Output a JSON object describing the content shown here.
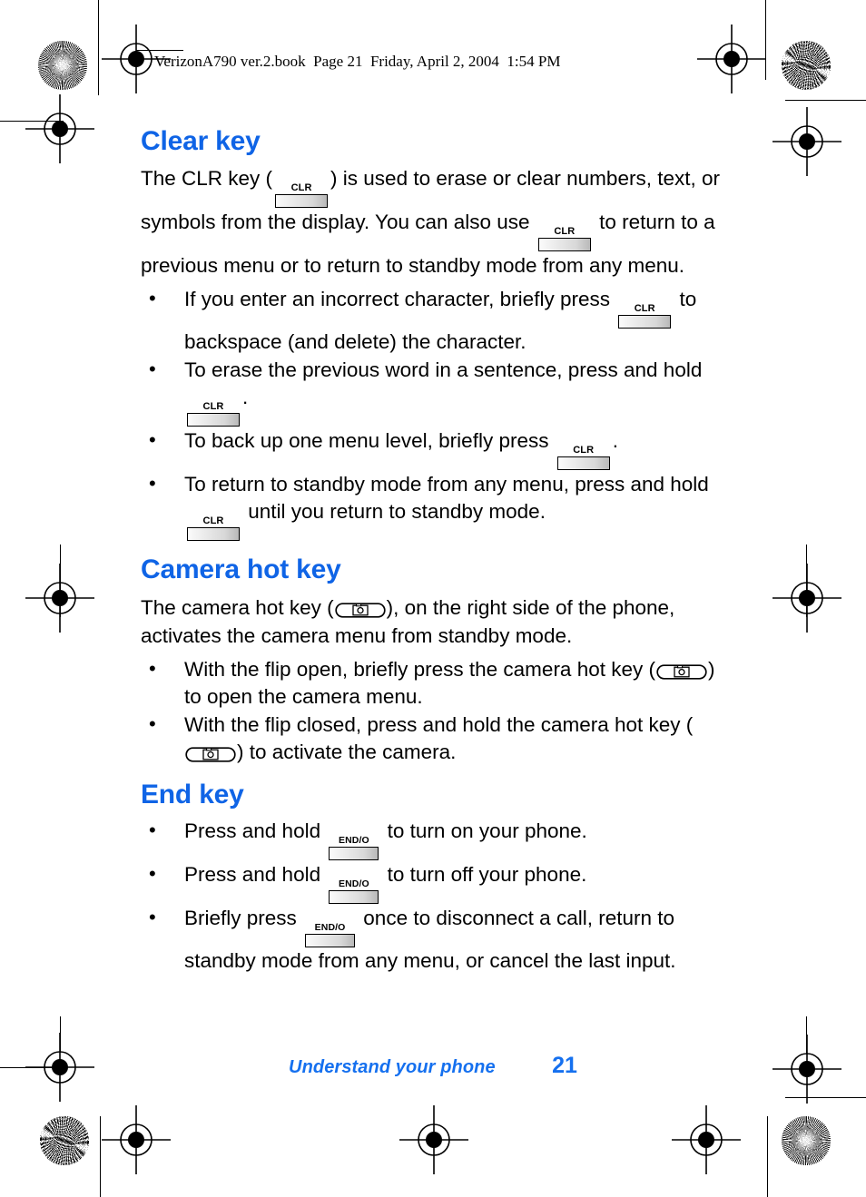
{
  "page_header": "VerizonA790 ver.2.book  Page 21  Friday, April 2, 2004  1:54 PM",
  "colors": {
    "heading_blue": "#0f64e6",
    "footer_blue": "#1570ef",
    "body_black": "#000000"
  },
  "keys": {
    "clr_label": "CLR",
    "end_label": "END/O",
    "camera_icon_name": "camera-hot-key-icon"
  },
  "sections": [
    {
      "id": "clear-key",
      "title": "Clear key",
      "paragraphs": [
        {
          "runs": [
            {
              "t": "text",
              "v": "The CLR key ("
            },
            {
              "t": "key-clr"
            },
            {
              "t": "text",
              "v": ") is used to erase or clear numbers, text, or symbols from the display. You can also use "
            },
            {
              "t": "key-clr"
            },
            {
              "t": "text",
              "v": " to return to a previous menu or to return to standby mode from any menu."
            }
          ]
        }
      ],
      "bullets": [
        {
          "runs": [
            {
              "t": "text",
              "v": "If you enter an incorrect character, briefly press "
            },
            {
              "t": "key-clr"
            },
            {
              "t": "text",
              "v": " to backspace (and delete) the character."
            }
          ]
        },
        {
          "runs": [
            {
              "t": "text",
              "v": "To erase the previous word in a sentence, press and hold "
            },
            {
              "t": "key-clr"
            },
            {
              "t": "text",
              "v": "."
            }
          ]
        },
        {
          "runs": [
            {
              "t": "text",
              "v": "To back up one menu level, briefly press "
            },
            {
              "t": "key-clr"
            },
            {
              "t": "text",
              "v": "."
            }
          ]
        },
        {
          "runs": [
            {
              "t": "text",
              "v": "To return to standby mode from any menu, press and hold "
            },
            {
              "t": "key-clr"
            },
            {
              "t": "text",
              "v": " until you return to standby mode."
            }
          ]
        }
      ]
    },
    {
      "id": "camera-hot-key",
      "title": "Camera hot key",
      "paragraphs": [
        {
          "runs": [
            {
              "t": "text",
              "v": "The camera hot key ("
            },
            {
              "t": "key-camera"
            },
            {
              "t": "text",
              "v": "), on the right side of the phone, activates the camera menu from standby mode."
            }
          ]
        }
      ],
      "bullets": [
        {
          "runs": [
            {
              "t": "text",
              "v": "With the flip open, briefly press the camera hot key ("
            },
            {
              "t": "key-camera"
            },
            {
              "t": "text",
              "v": ") to open the camera menu."
            }
          ]
        },
        {
          "runs": [
            {
              "t": "text",
              "v": "With the flip closed, press and hold the camera hot key ("
            },
            {
              "t": "key-camera"
            },
            {
              "t": "text",
              "v": ") to activate the camera."
            }
          ]
        }
      ]
    },
    {
      "id": "end-key",
      "title": "End key",
      "paragraphs": [],
      "bullets": [
        {
          "runs": [
            {
              "t": "text",
              "v": "Press and hold "
            },
            {
              "t": "key-end"
            },
            {
              "t": "text",
              "v": " to turn on your phone."
            }
          ]
        },
        {
          "runs": [
            {
              "t": "text",
              "v": "Press and hold "
            },
            {
              "t": "key-end"
            },
            {
              "t": "text",
              "v": " to turn off your phone."
            }
          ]
        },
        {
          "runs": [
            {
              "t": "text",
              "v": "Briefly press "
            },
            {
              "t": "key-end"
            },
            {
              "t": "text",
              "v": " once to disconnect a call, return to standby mode from any menu, or cancel the last input."
            }
          ]
        }
      ]
    }
  ],
  "footer": {
    "chapter": "Understand your phone",
    "page_number": "21"
  }
}
